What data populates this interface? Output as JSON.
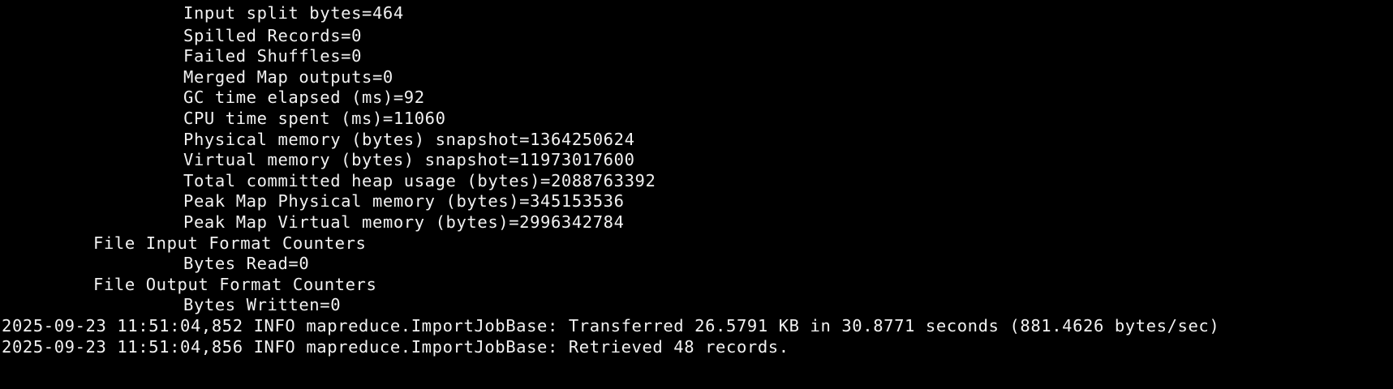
{
  "terminal": {
    "lines": [
      {
        "level": 2,
        "text": "Input split bytes=464"
      },
      {
        "level": 2,
        "text": "Spilled Records=0"
      },
      {
        "level": 2,
        "text": "Failed Shuffles=0"
      },
      {
        "level": 2,
        "text": "Merged Map outputs=0"
      },
      {
        "level": 2,
        "text": "GC time elapsed (ms)=92"
      },
      {
        "level": 2,
        "text": "CPU time spent (ms)=11060"
      },
      {
        "level": 2,
        "text": "Physical memory (bytes) snapshot=1364250624"
      },
      {
        "level": 2,
        "text": "Virtual memory (bytes) snapshot=11973017600"
      },
      {
        "level": 2,
        "text": "Total committed heap usage (bytes)=2088763392"
      },
      {
        "level": 2,
        "text": "Peak Map Physical memory (bytes)=345153536"
      },
      {
        "level": 2,
        "text": "Peak Map Virtual memory (bytes)=2996342784"
      },
      {
        "level": 1,
        "text": "File Input Format Counters"
      },
      {
        "level": 2,
        "text": "Bytes Read=0"
      },
      {
        "level": 1,
        "text": "File Output Format Counters"
      },
      {
        "level": 2,
        "text": "Bytes Written=0"
      },
      {
        "level": 0,
        "text": "2025-09-23 11:51:04,852 INFO mapreduce.ImportJobBase: Transferred 26.5791 KB in 30.8771 seconds (881.4626 bytes/sec)"
      },
      {
        "level": 0,
        "text": "2025-09-23 11:51:04,856 INFO mapreduce.ImportJobBase: Retrieved 48 records."
      }
    ]
  }
}
